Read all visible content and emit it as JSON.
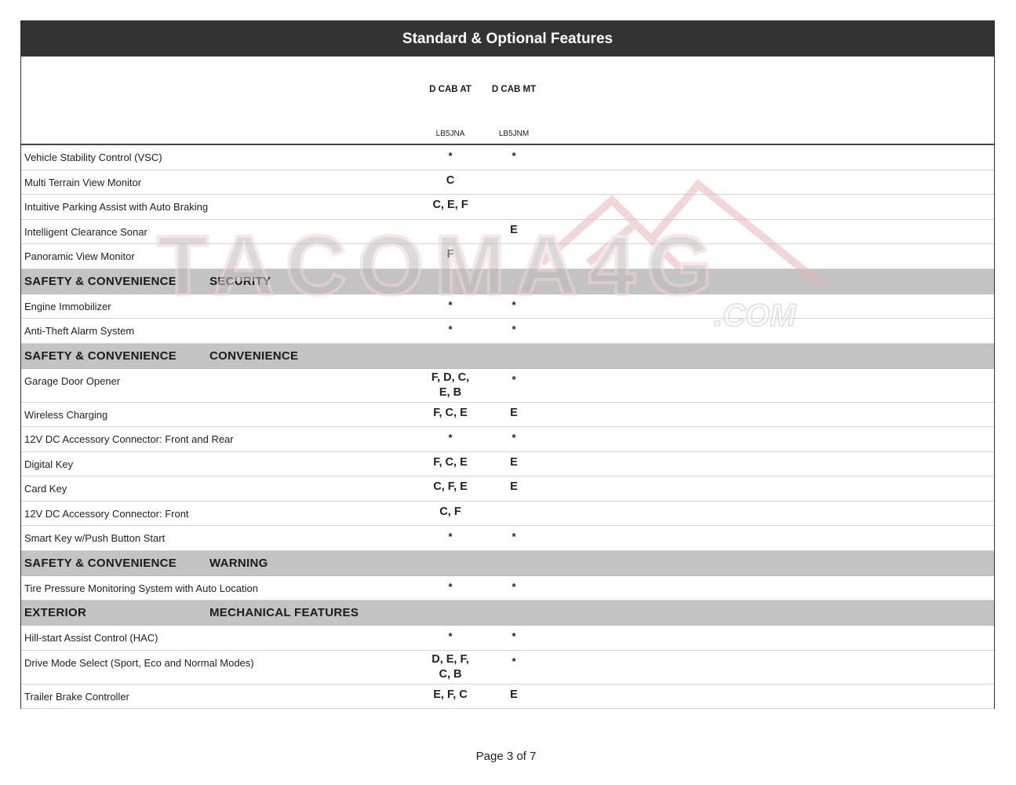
{
  "document": {
    "title": "Standard & Optional Features",
    "page_label": "Page 3 of 7",
    "watermark_text": "TACOMA4G",
    "watermark_suffix": ".COM"
  },
  "columns": [
    {
      "trim": "D CAB AT",
      "code": "LB5JNA"
    },
    {
      "trim": "D CAB MT",
      "code": "LB5JNM"
    }
  ],
  "rows": [
    {
      "type": "feature",
      "label": "Vehicle Stability Control  (VSC)",
      "values": [
        "*",
        "*"
      ]
    },
    {
      "type": "feature",
      "label": "Multi Terrain View Monitor",
      "values": [
        "C",
        ""
      ]
    },
    {
      "type": "feature",
      "label": "Intuitive Parking Assist with Auto Braking",
      "values": [
        "C, E, F",
        ""
      ]
    },
    {
      "type": "feature",
      "label": "Intelligent Clearance Sonar",
      "values": [
        "",
        "E"
      ]
    },
    {
      "type": "feature",
      "label": "Panoramic View Monitor",
      "values": [
        "F",
        ""
      ]
    },
    {
      "type": "section",
      "category": "SAFETY & CONVENIENCE",
      "subcategory": "SECURITY"
    },
    {
      "type": "feature",
      "label": "Engine Immobilizer",
      "values": [
        "*",
        "*"
      ]
    },
    {
      "type": "feature",
      "label": "Anti-Theft Alarm System",
      "values": [
        "*",
        "*"
      ]
    },
    {
      "type": "section",
      "category": "SAFETY & CONVENIENCE",
      "subcategory": "CONVENIENCE"
    },
    {
      "type": "feature",
      "label": "Garage Door Opener",
      "values": [
        "F, D, C, E, B",
        "*"
      ]
    },
    {
      "type": "feature",
      "label": "Wireless Charging",
      "values": [
        "F, C, E",
        "E"
      ]
    },
    {
      "type": "feature",
      "label": "12V DC Accessory Connector: Front and Rear",
      "values": [
        "*",
        "*"
      ]
    },
    {
      "type": "feature",
      "label": "Digital Key",
      "values": [
        "F, C, E",
        "E"
      ]
    },
    {
      "type": "feature",
      "label": "Card Key",
      "values": [
        "C, F, E",
        "E"
      ]
    },
    {
      "type": "feature",
      "label": "12V DC Accessory Connector: Front",
      "values": [
        "C, F",
        ""
      ]
    },
    {
      "type": "feature",
      "label": "Smart Key w/Push Button Start",
      "values": [
        "*",
        "*"
      ]
    },
    {
      "type": "section",
      "category": "SAFETY & CONVENIENCE",
      "subcategory": "WARNING"
    },
    {
      "type": "feature",
      "label": "Tire Pressure Monitoring System with Auto Location",
      "values": [
        "*",
        "*"
      ]
    },
    {
      "type": "section",
      "category": "EXTERIOR",
      "subcategory": "MECHANICAL FEATURES"
    },
    {
      "type": "feature",
      "label": "Hill-start Assist Control (HAC)",
      "values": [
        "*",
        "*"
      ]
    },
    {
      "type": "feature",
      "label": "Drive Mode Select (Sport, Eco and Normal Modes)",
      "values": [
        "D, E, F, C, B",
        "*"
      ]
    },
    {
      "type": "feature",
      "label": "Trailer Brake Controller",
      "values": [
        "E, F, C",
        "E"
      ]
    }
  ]
}
